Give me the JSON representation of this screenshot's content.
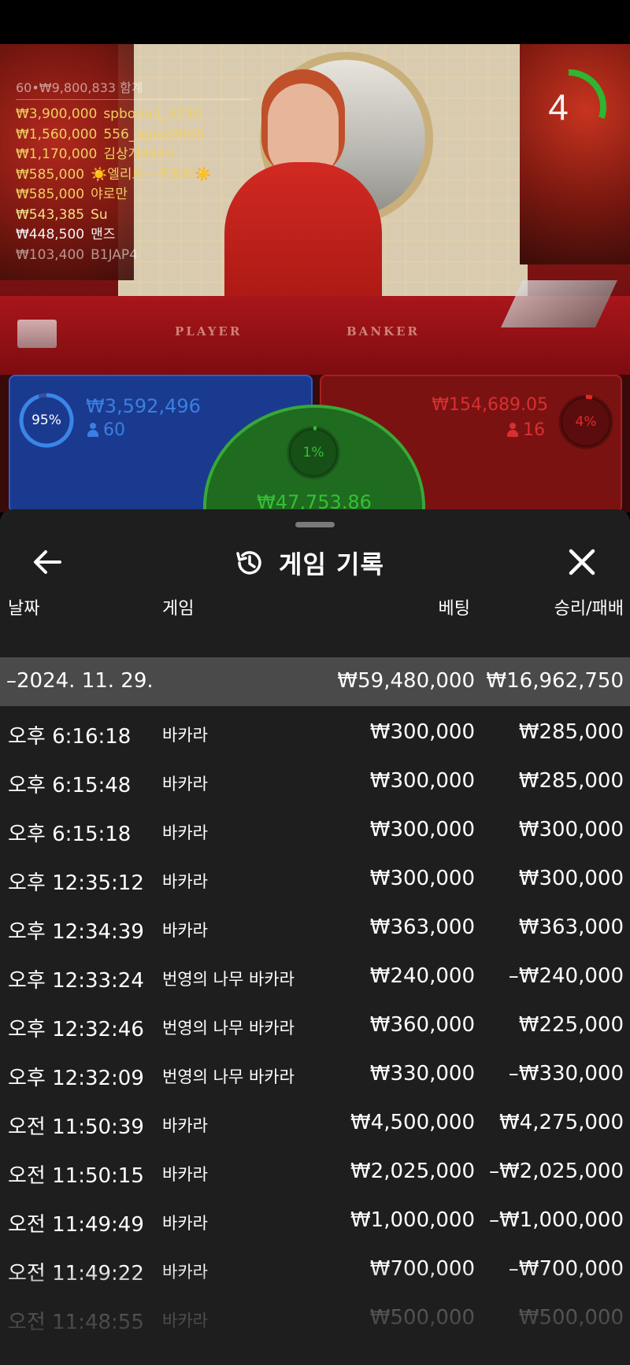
{
  "leaderboard": {
    "header": "60•₩9,800,833 함계",
    "entries": [
      {
        "amount": "₩3,900,000",
        "name": "spbomul_3230"
      },
      {
        "amount": "₩1,560,000",
        "name": "556_bjpss9905"
      },
      {
        "amount": "₩1,170,000",
        "name": "김상개4444"
      },
      {
        "amount": "₩585,000",
        "name": "☀️엘리트—꾸달하☀️"
      },
      {
        "amount": "₩585,000",
        "name": "야로만"
      },
      {
        "amount": "₩543,385",
        "name": "Su"
      },
      {
        "amount": "₩448,500",
        "name": "맨즈"
      },
      {
        "amount": "₩103,400",
        "name": "B1JAP4"
      }
    ]
  },
  "table": {
    "player_label": "PLAYER",
    "banker_label": "BANKER"
  },
  "timer": {
    "value": "4",
    "progress": 0.3
  },
  "bets": {
    "player": {
      "percent": "95%",
      "percent_value": 0.95,
      "amount": "₩3,592,496",
      "count": "60",
      "color": "#2f6fd6"
    },
    "banker": {
      "percent": "4%",
      "percent_value": 0.04,
      "amount": "₩154,689.05",
      "count": "16",
      "color": "#e02a2a"
    },
    "tie": {
      "percent": "1%",
      "percent_value": 0.01,
      "amount": "₩47,753.86",
      "color": "#35c035"
    }
  },
  "history": {
    "title": "게임 기록",
    "columns": {
      "date": "날짜",
      "game": "게임",
      "bet": "베팅",
      "result": "승리/패배"
    },
    "group": {
      "date": "–2024. 11. 29.",
      "bet_total": "₩59,480,000",
      "result_total": "₩16,962,750"
    },
    "rows": [
      {
        "time": "오후 6:16:18",
        "game": "바카라",
        "bet": "₩300,000",
        "result": "₩285,000"
      },
      {
        "time": "오후 6:15:48",
        "game": "바카라",
        "bet": "₩300,000",
        "result": "₩285,000"
      },
      {
        "time": "오후 6:15:18",
        "game": "바카라",
        "bet": "₩300,000",
        "result": "₩300,000"
      },
      {
        "time": "오후 12:35:12",
        "game": "바카라",
        "bet": "₩300,000",
        "result": "₩300,000"
      },
      {
        "time": "오후 12:34:39",
        "game": "바카라",
        "bet": "₩363,000",
        "result": "₩363,000"
      },
      {
        "time": "오후 12:33:24",
        "game": "번영의 나무 바카라",
        "bet": "₩240,000",
        "result": "–₩240,000"
      },
      {
        "time": "오후 12:32:46",
        "game": "번영의 나무 바카라",
        "bet": "₩360,000",
        "result": "₩225,000"
      },
      {
        "time": "오후 12:32:09",
        "game": "번영의 나무 바카라",
        "bet": "₩330,000",
        "result": "–₩330,000"
      },
      {
        "time": "오전 11:50:39",
        "game": "바카라",
        "bet": "₩4,500,000",
        "result": "₩4,275,000"
      },
      {
        "time": "오전 11:50:15",
        "game": "바카라",
        "bet": "₩2,025,000",
        "result": "–₩2,025,000"
      },
      {
        "time": "오전 11:49:49",
        "game": "바카라",
        "bet": "₩1,000,000",
        "result": "–₩1,000,000"
      },
      {
        "time": "오전 11:49:22",
        "game": "바카라",
        "bet": "₩700,000",
        "result": "–₩700,000"
      },
      {
        "time": "오전 11:48:55",
        "game": "바카라",
        "bet": "₩500,000",
        "result": "₩500,000"
      }
    ]
  },
  "icons": {
    "back": "arrow-left-icon",
    "history": "history-icon",
    "close": "close-icon",
    "person": "person-icon"
  }
}
